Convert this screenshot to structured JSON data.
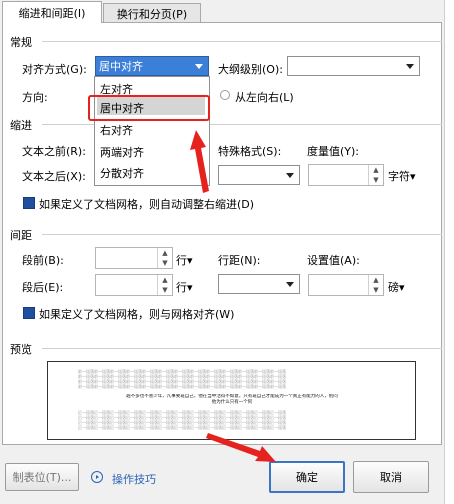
{
  "tabs": [
    "缩进和间距(I)",
    "换行和分页(P)"
  ],
  "sections": {
    "general": "常规",
    "indent": "缩进",
    "spacing": "间距",
    "preview": "预览"
  },
  "general": {
    "alignment_label": "对齐方式(G):",
    "alignment_value": "居中对齐",
    "outline_label": "大纲级别(O):",
    "outline_value": "",
    "direction_label": "方向:",
    "ltr_label": "从左向右(L)"
  },
  "alignment_options": [
    "左对齐",
    "居中对齐",
    "右对齐",
    "两端对齐",
    "分散对齐"
  ],
  "indent": {
    "before_label": "文本之前(R):",
    "after_label": "文本之后(X):",
    "special_label": "特殊格式(S):",
    "measure_label": "度量值(Y):",
    "measure_unit": "字符▾",
    "grid_check_label": "如果定义了文档网格，则自动调整右缩进(D)"
  },
  "spacing": {
    "before_label": "段前(B):",
    "before_unit": "行▾",
    "after_label": "段后(E):",
    "after_unit": "行▾",
    "line_spacing_label": "行距(N):",
    "setting_label": "设置值(A):",
    "setting_unit": "磅▾",
    "grid_check_label": "如果定义了文档网格，则与网格对齐(W)"
  },
  "preview_text": {
    "prev": "前一段落前一段落前一段落前一段落前一段落前一段落前一段落前一段落前一段落前一段落前一段落前一段落前一段落",
    "main1": "越不多也不害少年，凡事要靠自己，他在当中活得不如意，只有靠自己才能成为一个真正有能力的人，别问",
    "main2": "他为什么只有一个阿",
    "next": "后一段落后一段落后一段落后一段落后一段落后一段落后一段落后一段落后一段落后一段落后一段落后一段落后一段落"
  },
  "footer": {
    "tabstops_label": "制表位(T)...",
    "tips_label": "操作技巧",
    "ok_label": "确定",
    "cancel_label": "取消"
  },
  "colors": {
    "highlight": "#e5221d",
    "selected": "#3b7fd9",
    "check": "#1f4f9e"
  }
}
